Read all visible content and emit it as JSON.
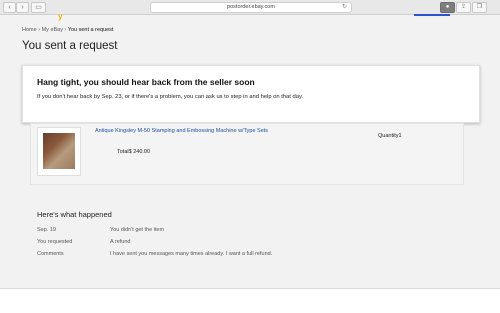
{
  "browser": {
    "url": "postorder.ebay.com",
    "back_icon": "chevron-left-icon",
    "forward_icon": "chevron-right-icon",
    "reload_icon": "reload-icon"
  },
  "breadcrumb": {
    "home": "Home",
    "sep1": "›",
    "my_ebay": "My eBay",
    "sep2": "›",
    "current": "You sent a request"
  },
  "page_title": "You sent a request",
  "notice": {
    "heading": "Hang tight, you should hear back from the seller soon",
    "body": "If you don't hear back by Sep. 23, or if there's a problem, you can ask us to step in and help on that day."
  },
  "item": {
    "title": "Antique Kingsley M-50 Stamping and Embossing Machine w/Type Sets",
    "total": "Total$ 240.00",
    "quantity": "Quantity1"
  },
  "history": {
    "title": "Here's what happened",
    "rows": [
      {
        "label": "Sep. 19",
        "value": "You didn't get the item"
      },
      {
        "label": "You requested",
        "value": "A refund"
      },
      {
        "label": "Comments",
        "value": "I have sent you messages many times already. I want a full refund."
      }
    ]
  },
  "colors": {
    "link": "#1a4fa3",
    "accent_blue": "#2855c9"
  }
}
